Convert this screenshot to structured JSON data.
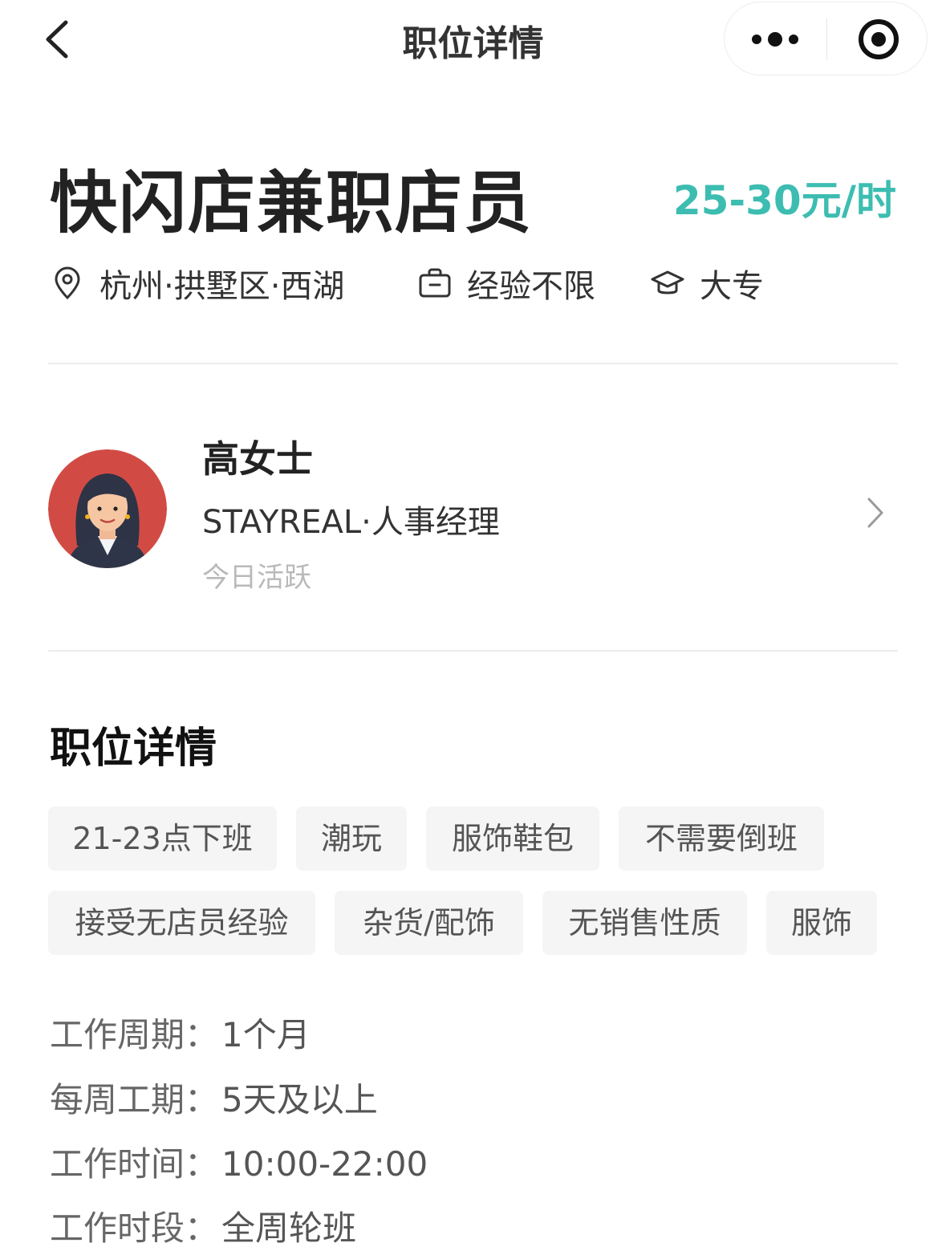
{
  "nav": {
    "title": "职位详情",
    "back_icon": "chevron-left-icon",
    "more_icon": "more-dots-icon",
    "close_icon": "target-circle-icon"
  },
  "job": {
    "title": "快闪店兼职店员",
    "salary": "25-30元/时",
    "salary_color": "#3dbdb1",
    "location": "杭州·拱墅区·西湖",
    "experience": "经验不限",
    "education": "大专"
  },
  "recruiter": {
    "name": "高女士",
    "company_role": "STAYREAL·人事经理",
    "activity": "今日活跃"
  },
  "details": {
    "section_title": "职位详情",
    "tags": [
      "21-23点下班",
      "潮玩",
      "服饰鞋包",
      "不需要倒班",
      "接受无店员经验",
      "杂货/配饰",
      "无销售性质",
      "服饰"
    ],
    "fields": [
      {
        "key": "工作周期：",
        "value": "1个月"
      },
      {
        "key": "每周工期：",
        "value": "5天及以上"
      },
      {
        "key": "工作时间：",
        "value": "10:00-22:00"
      },
      {
        "key": "工作时段：",
        "value": "全周轮班"
      }
    ]
  }
}
